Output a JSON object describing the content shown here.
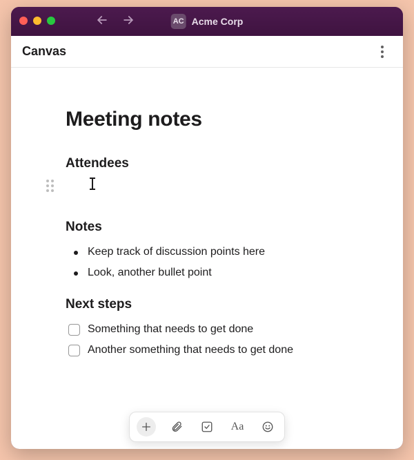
{
  "titlebar": {
    "workspace_abbrev": "AC",
    "workspace_name": "Acme Corp"
  },
  "header": {
    "title": "Canvas"
  },
  "document": {
    "title": "Meeting notes",
    "sections": {
      "attendees": {
        "heading": "Attendees"
      },
      "notes": {
        "heading": "Notes",
        "bullets": [
          "Keep track of discussion points here",
          "Look, another bullet point"
        ]
      },
      "next_steps": {
        "heading": "Next steps",
        "items": [
          {
            "text": "Something that needs to get done",
            "checked": false
          },
          {
            "text": "Another something that needs to get done",
            "checked": false
          }
        ]
      }
    }
  },
  "toolbar": {
    "text_format_label": "Aa"
  }
}
